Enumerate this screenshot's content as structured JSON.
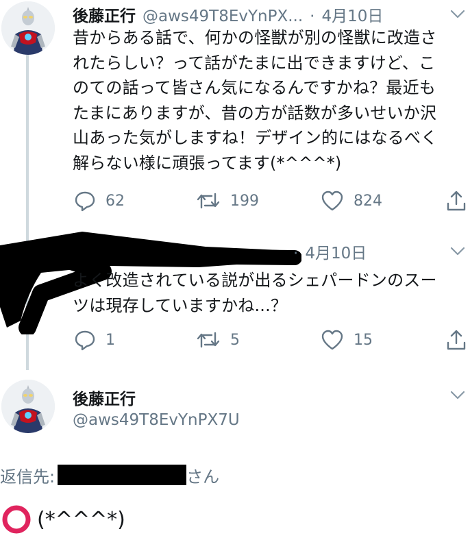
{
  "tweets": [
    {
      "author_name": "後藤正行",
      "author_handle": "@aws49T8EvYnPX...",
      "separator": "·",
      "date": "4月10日",
      "text_lines": [
        "昔からある話で、何かの怪獣が別の怪獣に改造さ",
        "れたらしい？って話がたまに出できますけど、こ",
        "のての話って皆さん気になるんですかね？最近も",
        "たまにありますが、昔の方が話数が多いせいか沢",
        "山あった気がしますね！デザイン的にはなるべく",
        "解らない様に頑張ってます(*^^^*)"
      ],
      "counts": {
        "reply": "62",
        "retweet": "199",
        "like": "824"
      }
    },
    {
      "separator": "·",
      "date": "4月10日",
      "text_lines": [
        "よく改造されている説が出るシェパードンのスー",
        "ツは現存していますかね...？"
      ],
      "counts": {
        "reply": "1",
        "retweet": "5",
        "like": "15"
      }
    }
  ],
  "focused": {
    "author_name": "後藤正行",
    "author_handle": "@aws49T8EvYnPX7U",
    "reply_to_prefix": "返信先:",
    "reply_to_suffix": "さん",
    "text": "(*^^^*)"
  },
  "colors": {
    "text": "#14171a",
    "muted": "#657786",
    "thread_line": "#cfd9de",
    "circle_emoji": "#e0245e"
  },
  "icons": [
    "reply-icon",
    "retweet-icon",
    "like-icon",
    "share-icon",
    "chevron-down-icon",
    "heavy-circle-icon"
  ]
}
